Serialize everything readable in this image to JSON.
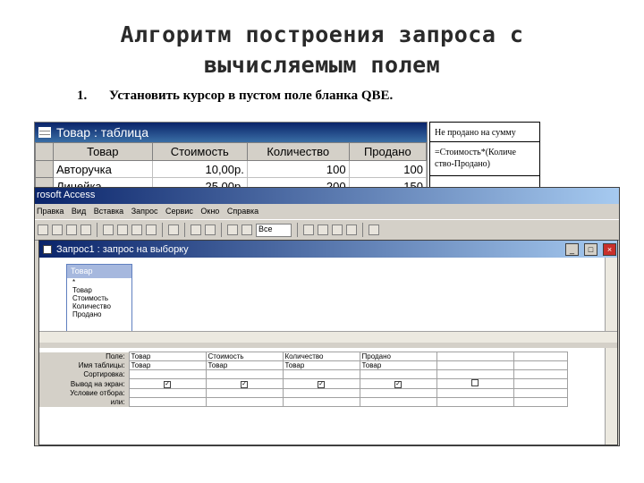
{
  "slide": {
    "title_line1": "Алгоритм построения запроса с",
    "title_line2": "вычисляемым полем",
    "step_num": "1.",
    "step_text": "Установить курсор в пустом поле бланка QBE."
  },
  "note": {
    "header": "Не продано на сумму",
    "expression": "=Стоимость*(Количе ство-Продано)"
  },
  "table_window": {
    "title": "Товар : таблица",
    "columns": [
      "Товар",
      "Стоимость",
      "Количество",
      "Продано"
    ],
    "rows": [
      [
        "Авторучка",
        "10,00р.",
        "100",
        "100"
      ],
      [
        "Линейка",
        "25,00р.",
        "200",
        "150"
      ]
    ]
  },
  "access_window": {
    "title": "rosoft Access",
    "menu": [
      "Правка",
      "Вид",
      "Вставка",
      "Запрос",
      "Сервис",
      "Окно",
      "Справка"
    ],
    "toolbar_select": "Все"
  },
  "query_window": {
    "title": "Запрос1 : запрос на выборку",
    "field_list_title": "Товар",
    "fields": [
      "*",
      "Товар",
      "Стоимость",
      "Количество",
      "Продано"
    ]
  },
  "qbe": {
    "row_labels": [
      "Поле:",
      "Имя таблицы:",
      "Сортировка:",
      "Вывод на экран:",
      "Условие отбора:",
      "или:"
    ],
    "columns": [
      {
        "field": "Товар",
        "table": "Товар",
        "show": true
      },
      {
        "field": "Стоимость",
        "table": "Товар",
        "show": true
      },
      {
        "field": "Количество",
        "table": "Товар",
        "show": true
      },
      {
        "field": "Продано",
        "table": "Товар",
        "show": true
      },
      {
        "field": "",
        "table": "",
        "show": false
      }
    ]
  }
}
